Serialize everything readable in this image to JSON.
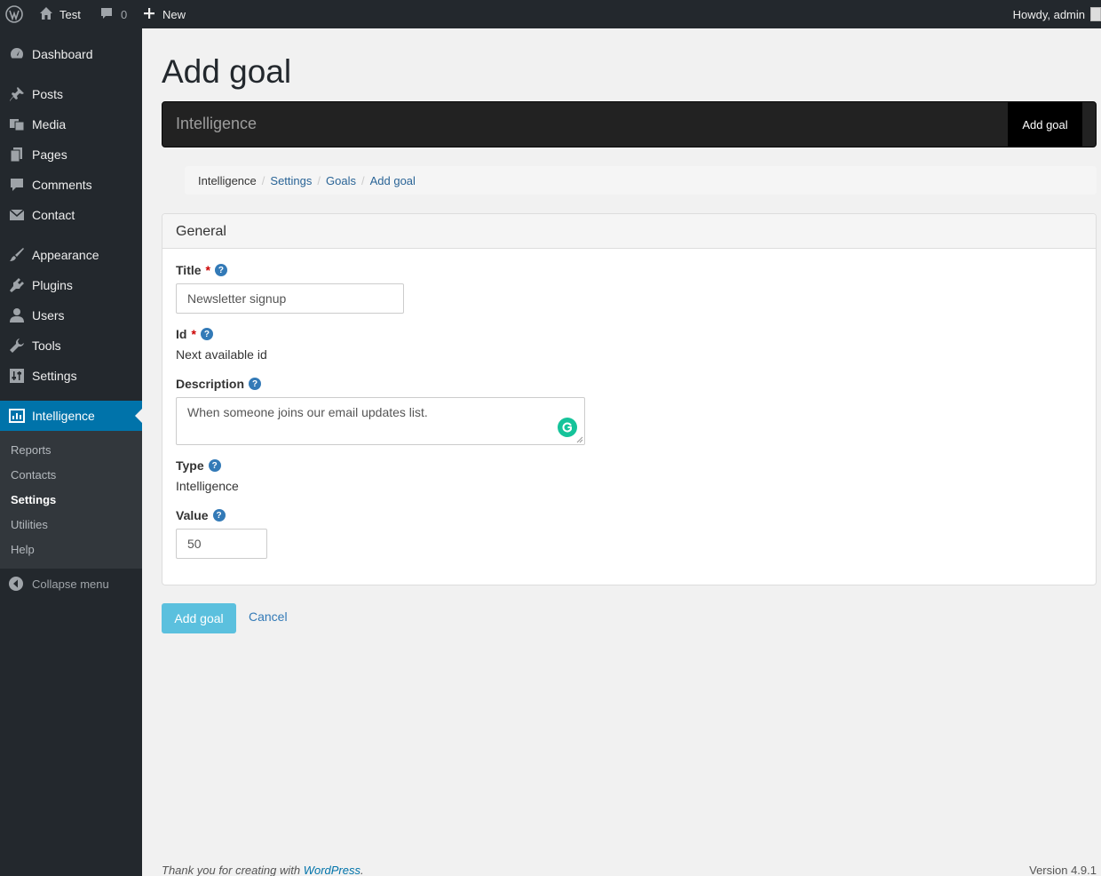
{
  "adminbar": {
    "site_name": "Test",
    "comments_count": "0",
    "new_label": "New",
    "howdy": "Howdy, admin"
  },
  "sidebar": {
    "items": [
      {
        "label": "Dashboard",
        "icon": "dashboard-icon"
      },
      {
        "label": "Posts",
        "icon": "pin-icon"
      },
      {
        "label": "Media",
        "icon": "media-icon"
      },
      {
        "label": "Pages",
        "icon": "pages-icon"
      },
      {
        "label": "Comments",
        "icon": "comment-icon"
      },
      {
        "label": "Contact",
        "icon": "envelope-icon"
      },
      {
        "label": "Appearance",
        "icon": "brush-icon"
      },
      {
        "label": "Plugins",
        "icon": "plug-icon"
      },
      {
        "label": "Users",
        "icon": "user-icon"
      },
      {
        "label": "Tools",
        "icon": "wrench-icon"
      },
      {
        "label": "Settings",
        "icon": "sliders-icon"
      },
      {
        "label": "Intelligence",
        "icon": "chart-icon"
      }
    ],
    "submenu": [
      "Reports",
      "Contacts",
      "Settings",
      "Utilities",
      "Help"
    ],
    "collapse_label": "Collapse menu"
  },
  "page": {
    "title": "Add goal",
    "brand": "Intelligence",
    "brand_button": "Add goal",
    "breadcrumb": [
      "Intelligence",
      "Settings",
      "Goals",
      "Add goal"
    ]
  },
  "panel": {
    "heading": "General",
    "title_label": "Title",
    "title_value": "Newsletter signup",
    "id_label": "Id",
    "id_value": "Next available id",
    "description_label": "Description",
    "description_value": "When someone joins our email updates list.",
    "type_label": "Type",
    "type_value": "Intelligence",
    "value_label": "Value",
    "value_value": "50",
    "required_mark": "*",
    "help_mark": "?"
  },
  "actions": {
    "submit": "Add goal",
    "cancel": "Cancel"
  },
  "footer": {
    "thanks_prefix": "Thank you for creating with ",
    "thanks_link": "WordPress",
    "thanks_suffix": ".",
    "version": "Version 4.9.1"
  },
  "colors": {
    "accent": "#0073aa",
    "admin_bg": "#23282d",
    "submit_button": "#5bc0de"
  }
}
